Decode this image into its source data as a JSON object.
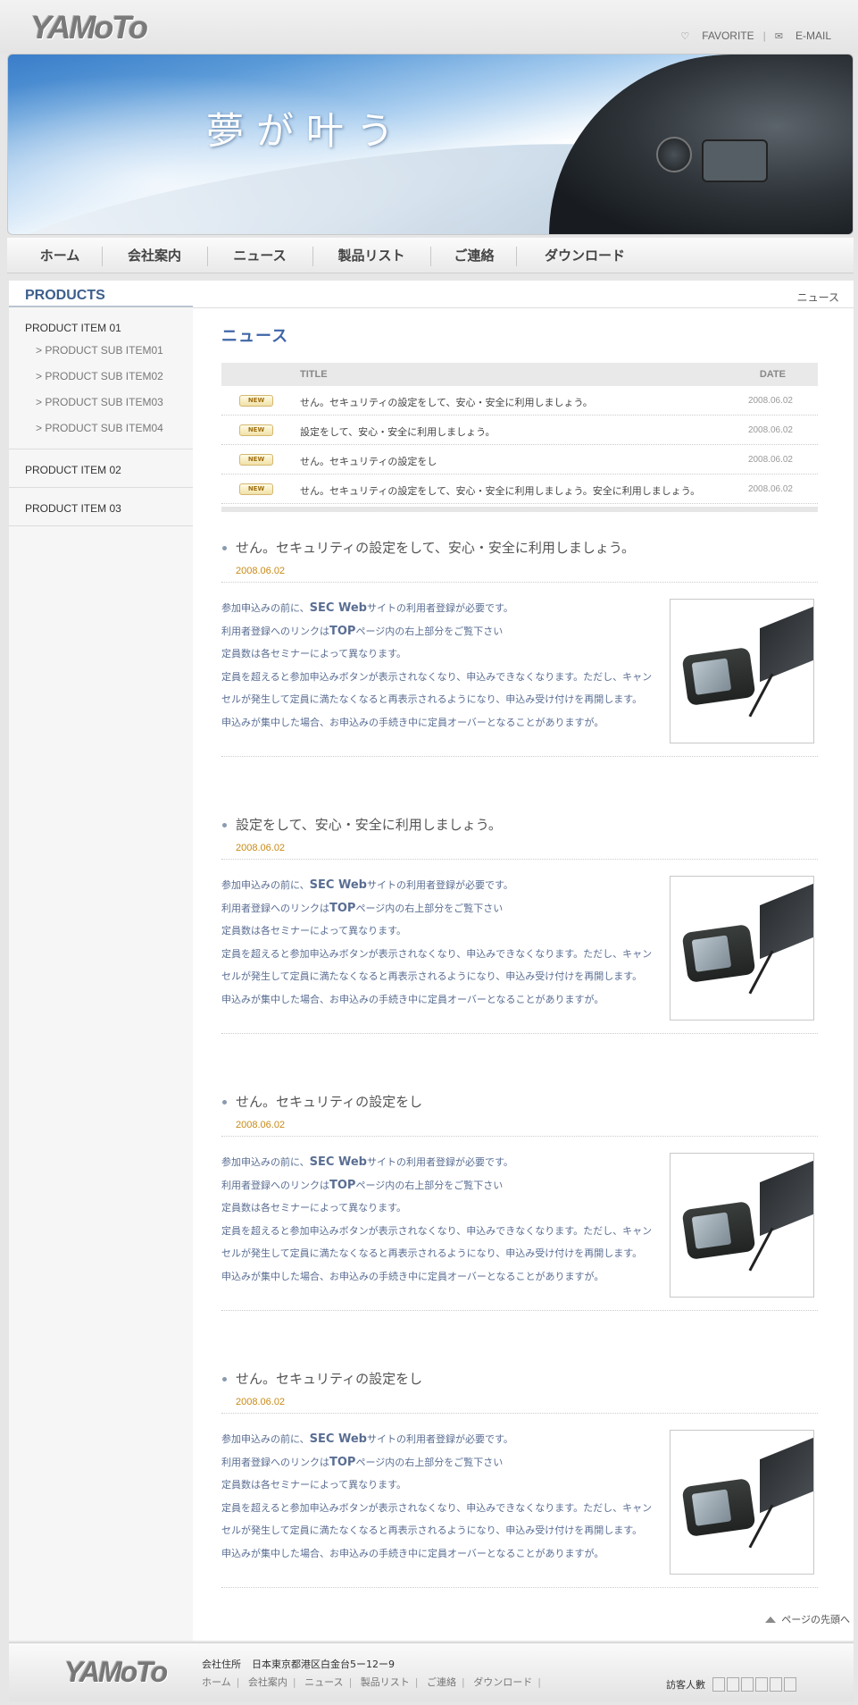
{
  "header": {
    "logo": "YAMoTo",
    "favorite": "FAVORITE",
    "email": "E-MAIL",
    "favorite_icon": "heart-icon",
    "email_icon": "envelope-icon"
  },
  "banner": {
    "title": "夢が叶う"
  },
  "nav": [
    "ホーム",
    "会社案内",
    "ニュース",
    "製品リスト",
    "ご連絡",
    "ダウンロード"
  ],
  "sidebar": {
    "title": "PRODUCTS",
    "item1": "PRODUCT ITEM 01",
    "subs": [
      "> PRODUCT SUB ITEM01",
      "> PRODUCT SUB ITEM02",
      "> PRODUCT SUB ITEM03",
      "> PRODUCT SUB ITEM04"
    ],
    "item2": "PRODUCT ITEM 02",
    "item3": "PRODUCT ITEM 03"
  },
  "main": {
    "breadcrumb": "ニュース",
    "title": "ニュース",
    "table": {
      "col_title": "TITLE",
      "col_date": "DATE",
      "badge": "NEW",
      "rows": [
        {
          "title": "せん。セキュリティの設定をして、安心・安全に利用しましょう。",
          "date": "2008.06.02"
        },
        {
          "title": "設定をして、安心・安全に利用しましょう。",
          "date": "2008.06.02"
        },
        {
          "title": "せん。セキュリティの設定をし",
          "date": "2008.06.02"
        },
        {
          "title": "せん。セキュリティの設定をして、安心・安全に利用しましょう。安全に利用しましょう。",
          "date": "2008.06.02"
        }
      ]
    },
    "body": {
      "l1a": "参加申込みの前に、",
      "l1b": "SEC Web",
      "l1c": "サイトの利用者登録が必要です。",
      "l2a": "利用者登録へのリンクは",
      "l2b": "TOP",
      "l2c": "ページ内の右上部分をご覧下さい",
      "l3": "定員数は各セミナーによって異なります。",
      "l4": "定員を超えると参加申込みボタンが表示されなくなり、申込みできなくなります。ただし、キャンセルが発生して定員に満たなくなると再表示されるようになり、申込み受け付けを再開します。",
      "l5": "申込みが集中した場合、お申込みの手続き中に定員オーバーとなることがありますが。"
    },
    "articles": [
      {
        "title": "せん。セキュリティの設定をして、安心・安全に利用しましょう。",
        "date": "2008.06.02"
      },
      {
        "title": "設定をして、安心・安全に利用しましょう。",
        "date": "2008.06.02"
      },
      {
        "title": "せん。セキュリティの設定をし",
        "date": "2008.06.02"
      },
      {
        "title": "せん。セキュリティの設定をし",
        "date": "2008.06.02"
      }
    ],
    "to_top": "ページの先頭へ"
  },
  "footer": {
    "logo": "YAMoTo",
    "address_label": "会社住所",
    "address": "日本東京都港区白金台5ー12ー9",
    "links": [
      "ホーム",
      "会社案内",
      "ニュース",
      "製品リスト",
      "ご連絡",
      "ダウンロード"
    ],
    "visitors_label": "訪客人數"
  }
}
